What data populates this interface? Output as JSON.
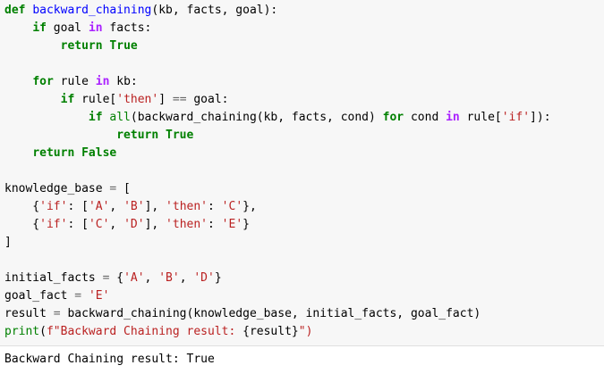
{
  "code": {
    "lines": [
      [
        {
          "t": "def",
          "c": "kw"
        },
        {
          "t": " "
        },
        {
          "t": "backward_chaining",
          "c": "fn"
        },
        {
          "t": "(kb, facts, goal):"
        }
      ],
      [
        {
          "t": "    "
        },
        {
          "t": "if",
          "c": "kw"
        },
        {
          "t": " goal "
        },
        {
          "t": "in",
          "c": "op"
        },
        {
          "t": " facts:"
        }
      ],
      [
        {
          "t": "        "
        },
        {
          "t": "return",
          "c": "kw"
        },
        {
          "t": " "
        },
        {
          "t": "True",
          "c": "kw"
        }
      ],
      [],
      [
        {
          "t": "    "
        },
        {
          "t": "for",
          "c": "kw"
        },
        {
          "t": " rule "
        },
        {
          "t": "in",
          "c": "op"
        },
        {
          "t": " kb:"
        }
      ],
      [
        {
          "t": "        "
        },
        {
          "t": "if",
          "c": "kw"
        },
        {
          "t": " rule["
        },
        {
          "t": "'then'",
          "c": "str"
        },
        {
          "t": "] "
        },
        {
          "t": "==",
          "c": "eq"
        },
        {
          "t": " goal:"
        }
      ],
      [
        {
          "t": "            "
        },
        {
          "t": "if",
          "c": "kw"
        },
        {
          "t": " "
        },
        {
          "t": "all",
          "c": "bi"
        },
        {
          "t": "(backward_chaining(kb, facts, cond) "
        },
        {
          "t": "for",
          "c": "kw"
        },
        {
          "t": " cond "
        },
        {
          "t": "in",
          "c": "op"
        },
        {
          "t": " rule["
        },
        {
          "t": "'if'",
          "c": "str"
        },
        {
          "t": "]):"
        }
      ],
      [
        {
          "t": "                "
        },
        {
          "t": "return",
          "c": "kw"
        },
        {
          "t": " "
        },
        {
          "t": "True",
          "c": "kw"
        }
      ],
      [
        {
          "t": "    "
        },
        {
          "t": "return",
          "c": "kw"
        },
        {
          "t": " "
        },
        {
          "t": "False",
          "c": "kw"
        }
      ],
      [],
      [
        {
          "t": "knowledge_base "
        },
        {
          "t": "=",
          "c": "eq"
        },
        {
          "t": " ["
        }
      ],
      [
        {
          "t": "    {"
        },
        {
          "t": "'if'",
          "c": "str"
        },
        {
          "t": ": ["
        },
        {
          "t": "'A'",
          "c": "str"
        },
        {
          "t": ", "
        },
        {
          "t": "'B'",
          "c": "str"
        },
        {
          "t": "], "
        },
        {
          "t": "'then'",
          "c": "str"
        },
        {
          "t": ": "
        },
        {
          "t": "'C'",
          "c": "str"
        },
        {
          "t": "},"
        }
      ],
      [
        {
          "t": "    {"
        },
        {
          "t": "'if'",
          "c": "str"
        },
        {
          "t": ": ["
        },
        {
          "t": "'C'",
          "c": "str"
        },
        {
          "t": ", "
        },
        {
          "t": "'D'",
          "c": "str"
        },
        {
          "t": "], "
        },
        {
          "t": "'then'",
          "c": "str"
        },
        {
          "t": ": "
        },
        {
          "t": "'E'",
          "c": "str"
        },
        {
          "t": "}"
        }
      ],
      [
        {
          "t": "]"
        }
      ],
      [],
      [
        {
          "t": "initial_facts "
        },
        {
          "t": "=",
          "c": "eq"
        },
        {
          "t": " {"
        },
        {
          "t": "'A'",
          "c": "str"
        },
        {
          "t": ", "
        },
        {
          "t": "'B'",
          "c": "str"
        },
        {
          "t": ", "
        },
        {
          "t": "'D'",
          "c": "str"
        },
        {
          "t": "}"
        }
      ],
      [
        {
          "t": "goal_fact "
        },
        {
          "t": "=",
          "c": "eq"
        },
        {
          "t": " "
        },
        {
          "t": "'E'",
          "c": "str"
        }
      ],
      [
        {
          "t": "result "
        },
        {
          "t": "=",
          "c": "eq"
        },
        {
          "t": " backward_chaining(knowledge_base, initial_facts, goal_fact)"
        }
      ],
      [
        {
          "t": "print",
          "c": "bi"
        },
        {
          "t": "("
        },
        {
          "t": "f\"Backward Chaining result: ",
          "c": "str"
        },
        {
          "t": "{result}"
        },
        {
          "t": "\")",
          "c": "str"
        }
      ]
    ]
  },
  "output": {
    "text": "Backward Chaining result: True"
  }
}
